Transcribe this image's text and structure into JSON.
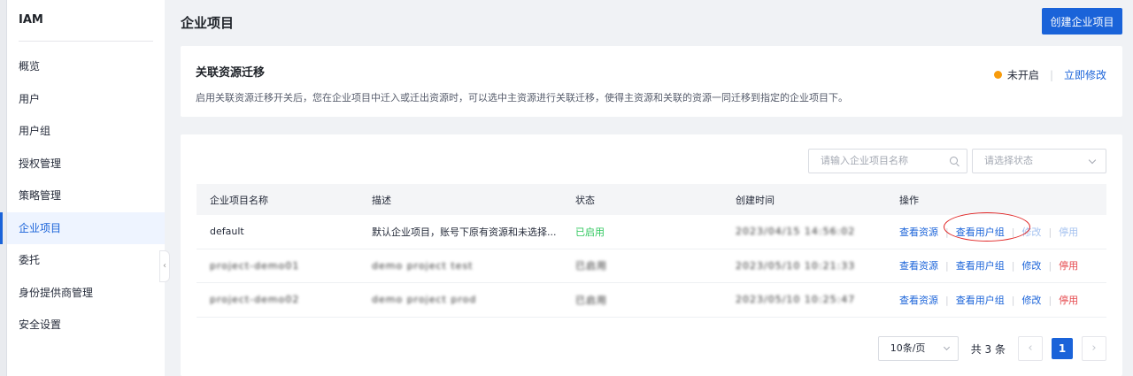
{
  "sidebar": {
    "brand": "IAM",
    "items": [
      {
        "label": "概览"
      },
      {
        "label": "用户"
      },
      {
        "label": "用户组"
      },
      {
        "label": "授权管理"
      },
      {
        "label": "策略管理"
      },
      {
        "label": "企业项目"
      },
      {
        "label": "委托"
      },
      {
        "label": "身份提供商管理"
      },
      {
        "label": "安全设置"
      }
    ],
    "active_index": 5,
    "collapse_glyph": "‹"
  },
  "header": {
    "title": "企业项目",
    "create_button": "创建企业项目"
  },
  "migration": {
    "title": "关联资源迁移",
    "description": "启用关联资源迁移开关后，您在企业项目中迁入或迁出资源时，可以选中主资源进行关联迁移，使得主资源和关联的资源一同迁移到指定的企业项目下。",
    "status": "未开启",
    "action": "立即修改",
    "status_color": "#f79b0b"
  },
  "filters": {
    "search_placeholder": "请输入企业项目名称",
    "status_placeholder": "请选择状态"
  },
  "table": {
    "headers": [
      "企业项目名称",
      "描述",
      "状态",
      "创建时间",
      "操作"
    ],
    "rows": [
      {
        "name": "default",
        "desc": "默认企业项目，账号下原有资源和未选择...",
        "status": "已启用",
        "created": "2023/04/15 14:56:02",
        "op_view_res": "查看资源",
        "op_view_group": "查看用户组",
        "op_edit": "修改",
        "op_disable": "停用"
      },
      {
        "name": "project-demo01",
        "desc": "demo project test",
        "status": "已启用",
        "created": "2023/05/10 10:21:33",
        "op_view_res": "查看资源",
        "op_view_group": "查看用户组",
        "op_edit": "修改",
        "op_disable": "停用"
      },
      {
        "name": "project-demo02",
        "desc": "demo project prod",
        "status": "已启用",
        "created": "2023/05/10 10:25:47",
        "op_view_res": "查看资源",
        "op_view_group": "查看用户组",
        "op_edit": "修改",
        "op_disable": "停用"
      }
    ]
  },
  "pagination": {
    "page_size": "10条/页",
    "total": "共 3 条",
    "prev": "‹",
    "next": "›",
    "current": "1"
  },
  "colors": {
    "accent": "#1a63d9",
    "danger": "#e5484d",
    "success": "#2fc75e",
    "annotation": "#e02222"
  }
}
